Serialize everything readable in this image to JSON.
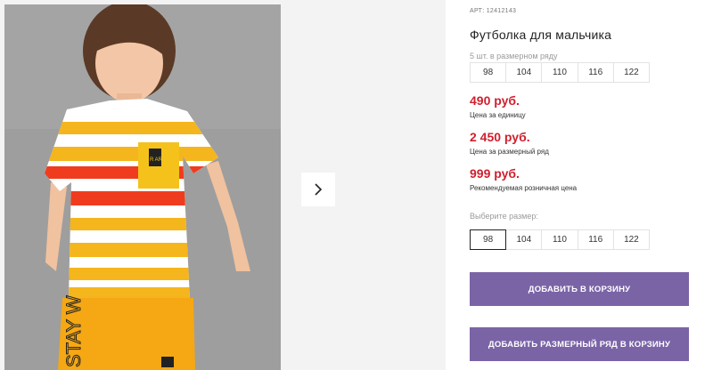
{
  "product": {
    "article_label": "АРТ:",
    "article": "12412143",
    "title": "Футболка для мальчика",
    "pack_label": "5 шт. в размерном ряду",
    "pack_sizes": [
      "98",
      "104",
      "110",
      "116",
      "122"
    ],
    "price_unit": "490 руб.",
    "price_unit_note": "Цена за единицу",
    "price_pack": "2 450 руб.",
    "price_pack_note": "Цена за размерный ряд",
    "price_retail": "999 руб.",
    "price_retail_note": "Рекомендуемая розничная цена",
    "choose_size_label": "Выберите размер:",
    "sizes": [
      "98",
      "104",
      "110",
      "116",
      "122"
    ],
    "selected_size": "98",
    "add_to_cart": "ДОБАВИТЬ В КОРЗИНУ",
    "add_pack_to_cart": "ДОБАВИТЬ РАЗМЕРНЫЙ РЯД В КОРЗИНУ",
    "photo_badge": "R AR",
    "photo_shorts_text": "STAY W"
  },
  "colors": {
    "price": "#d01f2d",
    "button": "#7a64a6"
  },
  "icons": {
    "next": "chevron-right-icon"
  }
}
